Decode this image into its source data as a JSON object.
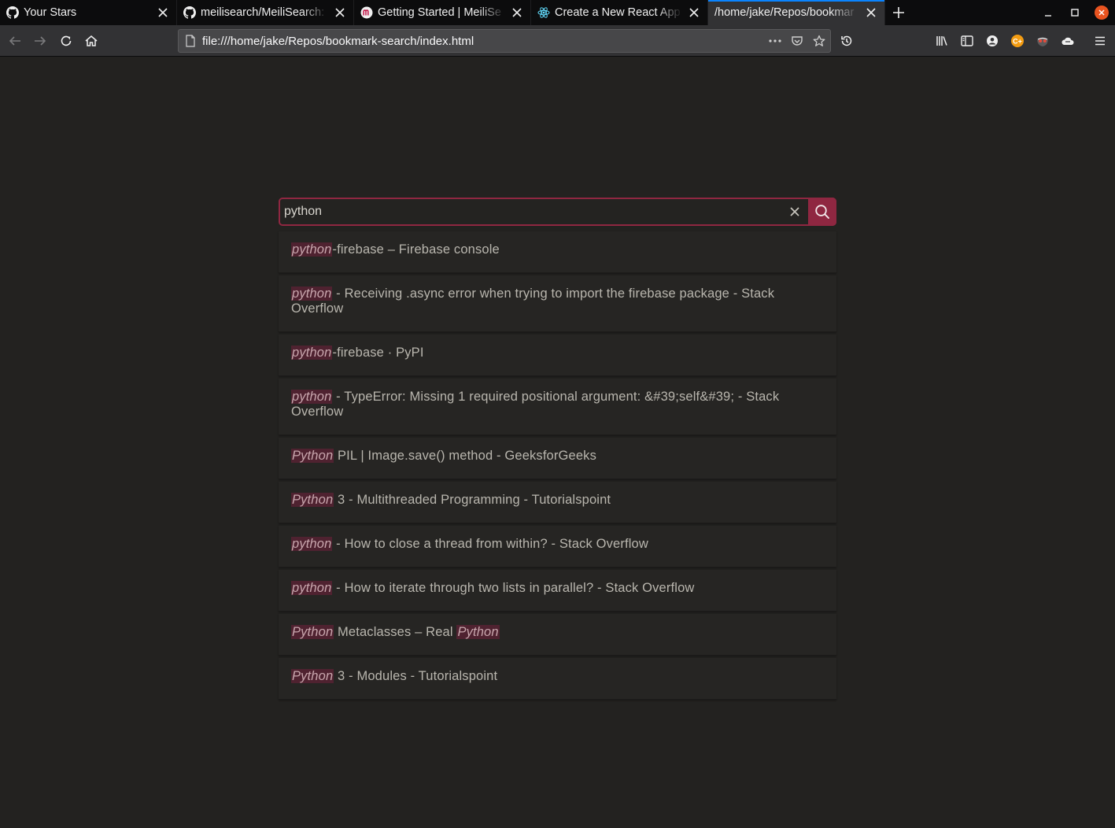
{
  "browser": {
    "tabs": [
      {
        "title": "Your Stars",
        "icon": "github-icon",
        "active": false
      },
      {
        "title": "meilisearch/MeiliSearch:",
        "icon": "github-icon",
        "active": false
      },
      {
        "title": "Getting Started | MeiliSe",
        "icon": "meilisearch-icon",
        "active": false
      },
      {
        "title": "Create a New React App",
        "icon": "react-icon",
        "active": false
      },
      {
        "title": "/home/jake/Repos/bookmar",
        "icon": "",
        "active": true
      }
    ],
    "url": "file:///home/jake/Repos/bookmark-search/index.html"
  },
  "search": {
    "value": "python",
    "accent_color": "#8f2741",
    "highlight_color": "#4f2230"
  },
  "results": [
    {
      "parts": [
        {
          "hl": "python"
        },
        {
          "t": "-firebase – Firebase console"
        }
      ]
    },
    {
      "parts": [
        {
          "hl": "python"
        },
        {
          "t": " - Receiving .async error when trying to import the firebase package - Stack Overflow"
        }
      ]
    },
    {
      "parts": [
        {
          "hl": "python"
        },
        {
          "t": "-firebase · PyPI"
        }
      ]
    },
    {
      "parts": [
        {
          "hl": "python"
        },
        {
          "t": " - TypeError: Missing 1 required positional argument: &#39;self&#39; - Stack Overflow"
        }
      ]
    },
    {
      "parts": [
        {
          "hl": "Python"
        },
        {
          "t": " PIL | Image.save() method - GeeksforGeeks"
        }
      ]
    },
    {
      "parts": [
        {
          "hl": "Python"
        },
        {
          "t": " 3 - Multithreaded Programming - Tutorialspoint"
        }
      ]
    },
    {
      "parts": [
        {
          "hl": "python"
        },
        {
          "t": " - How to close a thread from within? - Stack Overflow"
        }
      ]
    },
    {
      "parts": [
        {
          "hl": "python"
        },
        {
          "t": " - How to iterate through two lists in parallel? - Stack Overflow"
        }
      ]
    },
    {
      "parts": [
        {
          "hl": "Python"
        },
        {
          "t": " Metaclasses – Real "
        },
        {
          "hl": "Python"
        }
      ]
    },
    {
      "parts": [
        {
          "hl": "Python"
        },
        {
          "t": " 3 - Modules - Tutorialspoint"
        }
      ]
    }
  ]
}
